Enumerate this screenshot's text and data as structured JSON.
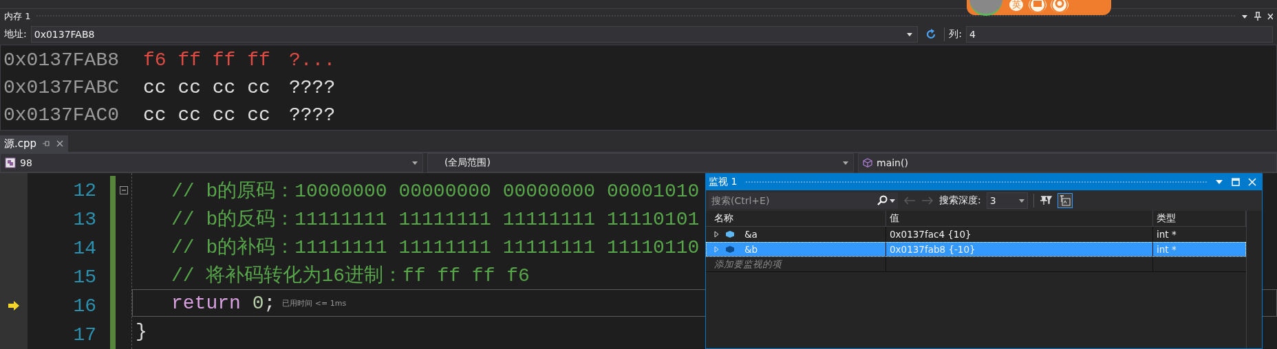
{
  "ime_toolbar": {
    "label": "英"
  },
  "memory_window": {
    "title": "内存 1",
    "address_label": "地址:",
    "address": "0x0137FAB8",
    "columns_label": "列:",
    "columns": "4",
    "rows": [
      {
        "address": "0x0137FAB8",
        "bytes": "f6 ff ff ff",
        "text": "?...",
        "changed": true
      },
      {
        "address": "0x0137FABC",
        "bytes": "cc cc cc cc",
        "text": "????",
        "changed": false
      },
      {
        "address": "0x0137FAC0",
        "bytes": "cc cc cc cc",
        "text": "????",
        "changed": false
      }
    ]
  },
  "editor": {
    "tab": {
      "label": "源.cpp",
      "selected": true
    },
    "nav": {
      "project": "98",
      "scope": "(全局范围)",
      "function": "main()"
    },
    "lines": [
      {
        "number": "12",
        "current": false,
        "collapsible": true,
        "tokens": [
          {
            "kind": "comment",
            "text": "// b的原码：10000000 00000000 00000000 00001010"
          }
        ]
      },
      {
        "number": "13",
        "current": false,
        "collapsible": false,
        "tokens": [
          {
            "kind": "comment",
            "text": "// b的反码：11111111 11111111 11111111 11110101"
          }
        ]
      },
      {
        "number": "14",
        "current": false,
        "collapsible": false,
        "tokens": [
          {
            "kind": "comment",
            "text": "// b的补码：11111111 11111111 11111111 11110110"
          }
        ]
      },
      {
        "number": "15",
        "current": false,
        "collapsible": false,
        "tokens": [
          {
            "kind": "comment",
            "text": "// 将补码转化为16进制：ff ff ff f6"
          }
        ]
      },
      {
        "number": "16",
        "current": true,
        "collapsible": false,
        "tokens": [
          {
            "kind": "keyword",
            "text": "return "
          },
          {
            "kind": "number",
            "text": "0"
          },
          {
            "kind": "plain",
            "text": ";"
          }
        ],
        "perf_tip": "已用时间 <= 1ms"
      },
      {
        "number": "17",
        "current": false,
        "collapsible": false,
        "outdent": true,
        "tokens": [
          {
            "kind": "plain",
            "text": "}"
          }
        ]
      }
    ]
  },
  "watch_window": {
    "title": "监视 1",
    "search_placeholder": "搜索(Ctrl+E)",
    "depth_label": "搜索深度:",
    "depth": "3",
    "columns": [
      "名称",
      "值",
      "类型"
    ],
    "rows": [
      {
        "name": "&a",
        "value": "0x0137fac4 {10}",
        "type": "int *",
        "selected": false
      },
      {
        "name": "&b",
        "value": "0x0137fab8 {-10}",
        "type": "int *",
        "selected": true
      }
    ],
    "add_placeholder": "添加要监视的项"
  }
}
